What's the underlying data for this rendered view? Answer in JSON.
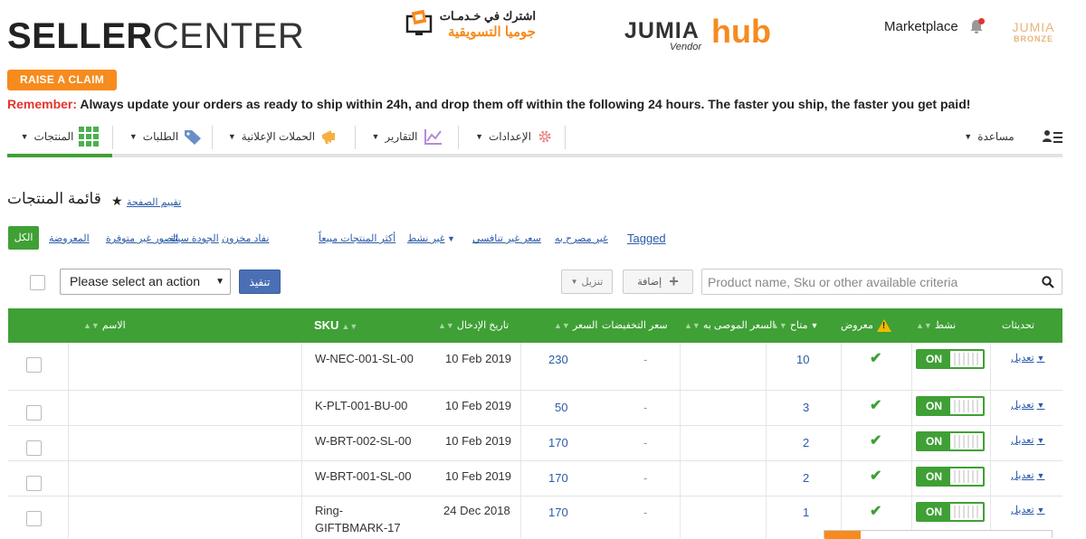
{
  "header": {
    "logo_bold": "SELLER",
    "logo_light": "CENTER",
    "promo_line1": "اشترك في خـدمـات",
    "promo_line2": "جوميا التسويقية",
    "vendor_brand": "JUMIA",
    "vendor_sub": "Vendor",
    "vendor_hub": "hub",
    "marketplace": "Marketplace",
    "badge_brand": "JUMIA",
    "badge_tier": "BRONZE",
    "brand_color": "#f68b1e"
  },
  "claim_button": "RAISE A CLAIM",
  "notice": {
    "label": "Remember:",
    "text": " Always update your orders as ready to ship within 24h, and drop them off within the following 24 hours. The faster you ship, the faster you get paid!"
  },
  "nav": {
    "items": [
      {
        "label": "المنتجات",
        "icon": "grid-icon",
        "active": true
      },
      {
        "label": "الطلبات",
        "icon": "tag-icon"
      },
      {
        "label": "الحملات الإعلانية",
        "icon": "megaphone-icon"
      },
      {
        "label": "التقارير",
        "icon": "chart-icon"
      },
      {
        "label": "الإعدادات",
        "icon": "gear-icon"
      }
    ],
    "help": "مساعدة",
    "accent": "#3fa035"
  },
  "page": {
    "title": "قائمة المنتجات",
    "rate_link": "تقييم الصفحة"
  },
  "filters": {
    "all": "الكل",
    "items": [
      "المعروضة",
      "الصور غير متوفرة",
      "الجودة سيئة",
      "نفاد مخزون",
      "أكثر المنتجات مبيعاً",
      "غير نشط",
      "سعر غير تنافسي",
      "غير مصرح به",
      "Tagged"
    ]
  },
  "toolbar": {
    "action_placeholder": "Please select an action",
    "run": "تنفيذ",
    "export": "تنزيل",
    "add": "إضافة",
    "search_placeholder": "Product name, Sku or other available criteria"
  },
  "table": {
    "headers": {
      "name": "الاسم",
      "sku": "SKU",
      "created": "تاريخ الإدخال",
      "price": "السعر",
      "sale_price": "سعر التخفيضات",
      "rrp": "السعر الموصى به",
      "available": "متاح",
      "visible": "معروض",
      "active": "نشط",
      "actions": "تحديثات"
    },
    "rows": [
      {
        "sku": "W-NEC-001-SL-00",
        "date": "10 Feb 2019",
        "price": "230",
        "sale": "-",
        "qty": "10",
        "toggle": "ON",
        "edit": "تعديل"
      },
      {
        "sku": "K-PLT-001-BU-00",
        "date": "10 Feb 2019",
        "price": "50",
        "sale": "-",
        "qty": "3",
        "toggle": "ON",
        "edit": "تعديل"
      },
      {
        "sku": "W-BRT-002-SL-00",
        "date": "10 Feb 2019",
        "price": "170",
        "sale": "-",
        "qty": "2",
        "toggle": "ON",
        "edit": "تعديل"
      },
      {
        "sku": "W-BRT-001-SL-00",
        "date": "10 Feb 2019",
        "price": "170",
        "sale": "-",
        "qty": "2",
        "toggle": "ON",
        "edit": "تعديل"
      },
      {
        "sku_line1": "Ring-",
        "sku_line2": "GIFTBMARK-17",
        "date": "24 Dec 2018",
        "price": "170",
        "sale": "-",
        "qty": "1",
        "toggle": "ON",
        "edit": "تعديل"
      }
    ]
  }
}
